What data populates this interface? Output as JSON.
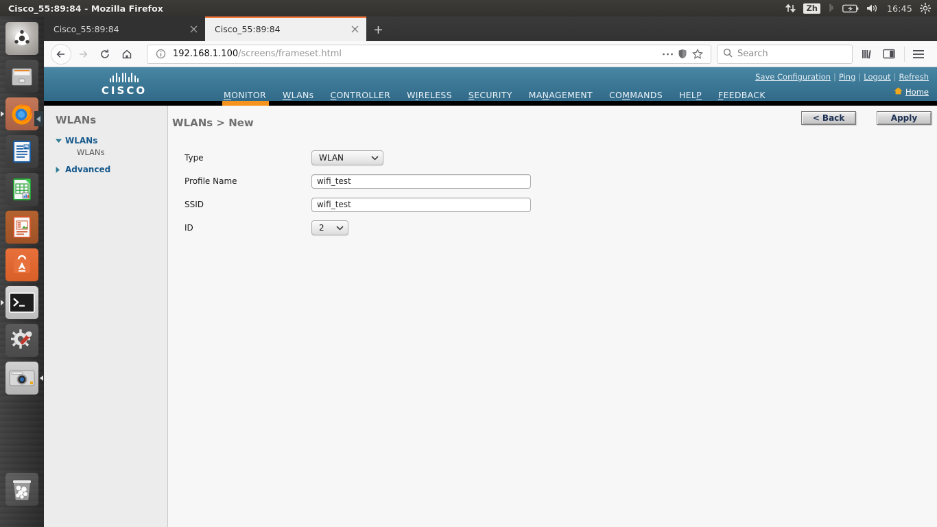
{
  "desktop": {
    "window_title": "Cisco_55:89:84 - Mozilla Firefox",
    "tray": {
      "network_icon": "network-up-down-icon",
      "input_method": "Zh",
      "bluetooth_icon": "bluetooth-icon",
      "battery_icon": "battery-charging-icon",
      "volume_icon": "volume-icon",
      "clock": "16:45",
      "session_icon": "system-gear-icon"
    },
    "launcher": [
      {
        "name": "dash-home",
        "label": "Ubuntu Dash",
        "running": false
      },
      {
        "name": "files",
        "label": "Files",
        "running": false
      },
      {
        "name": "firefox",
        "label": "Firefox Web Browser",
        "running": true
      },
      {
        "name": "libreoffice-writer",
        "label": "LibreOffice Writer",
        "running": false
      },
      {
        "name": "libreoffice-calc",
        "label": "LibreOffice Calc",
        "running": false
      },
      {
        "name": "libreoffice-impress",
        "label": "LibreOffice Impress",
        "running": false
      },
      {
        "name": "ubuntu-software",
        "label": "Ubuntu Software",
        "running": false
      },
      {
        "name": "terminal",
        "label": "Terminal",
        "running": true
      },
      {
        "name": "system-settings",
        "label": "System Settings",
        "running": false
      },
      {
        "name": "camera",
        "label": "Camera",
        "running": true
      },
      {
        "name": "trash",
        "label": "Trash",
        "running": false
      }
    ]
  },
  "browser": {
    "tabs": [
      {
        "title": "Cisco_55:89:84",
        "active": false
      },
      {
        "title": "Cisco_55:89:84",
        "active": true
      }
    ],
    "new_tab_label": "+",
    "toolbar": {
      "back_icon": "back-arrow-icon",
      "forward_icon": "forward-arrow-icon",
      "reload_icon": "reload-icon",
      "home_icon": "home-icon",
      "library_icon": "library-icon",
      "sidebar_icon": "sidebar-icon",
      "menu_icon": "hamburger-menu-icon"
    },
    "urlbar": {
      "identity_icon": "info-circle-icon",
      "host": "192.168.1.100",
      "path": "/screens/frameset.html",
      "page_actions_icon": "ellipsis-icon",
      "shield_icon": "shield-icon",
      "bookmark_icon": "star-icon"
    },
    "search": {
      "placeholder": "Search",
      "icon": "search-icon"
    }
  },
  "cisco": {
    "brand": "CISCO",
    "header_links": [
      {
        "label": "Save Configuration",
        "accesskey_index": 3
      },
      {
        "label": "Ping",
        "accesskey_index": 0
      },
      {
        "label": "Logout",
        "accesskey_index": 2
      },
      {
        "label": "Refresh",
        "accesskey_index": 0
      }
    ],
    "home": {
      "label": "Home",
      "icon": "home-house-icon"
    },
    "nav": [
      {
        "label": "MONITOR",
        "accesskey_index": 0,
        "active": false
      },
      {
        "label": "WLANs",
        "accesskey_index": 0,
        "active": true
      },
      {
        "label": "CONTROLLER",
        "accesskey_index": 0,
        "active": false
      },
      {
        "label": "WIRELESS",
        "accesskey_index": 1,
        "active": false
      },
      {
        "label": "SECURITY",
        "accesskey_index": 0,
        "active": false
      },
      {
        "label": "MANAGEMENT",
        "accesskey_index": 2,
        "active": false
      },
      {
        "label": "COMMANDS",
        "accesskey_index": 2,
        "active": false
      },
      {
        "label": "HELP",
        "accesskey_index": 3,
        "active": false
      },
      {
        "label": "FEEDBACK",
        "accesskey_index": 0,
        "active": false
      }
    ],
    "sidebar": {
      "title": "WLANs",
      "tree": [
        {
          "label": "WLANs",
          "expanded": true,
          "children": [
            "WLANs"
          ]
        },
        {
          "label": "Advanced",
          "expanded": false,
          "children": []
        }
      ]
    },
    "main": {
      "breadcrumb": "WLANs > New",
      "buttons": {
        "back": "< Back",
        "apply": "Apply"
      },
      "form": {
        "type": {
          "label": "Type",
          "value": "WLAN"
        },
        "profile_name": {
          "label": "Profile Name",
          "value": "wifi_test"
        },
        "ssid": {
          "label": "SSID",
          "value": "wifi_test"
        },
        "id": {
          "label": "ID",
          "value": "2"
        }
      }
    },
    "colors": {
      "header_top": "#4a87a4",
      "header_bottom": "#2f6685",
      "accent_orange": "#f6921e",
      "link_blue": "#16598c"
    }
  }
}
